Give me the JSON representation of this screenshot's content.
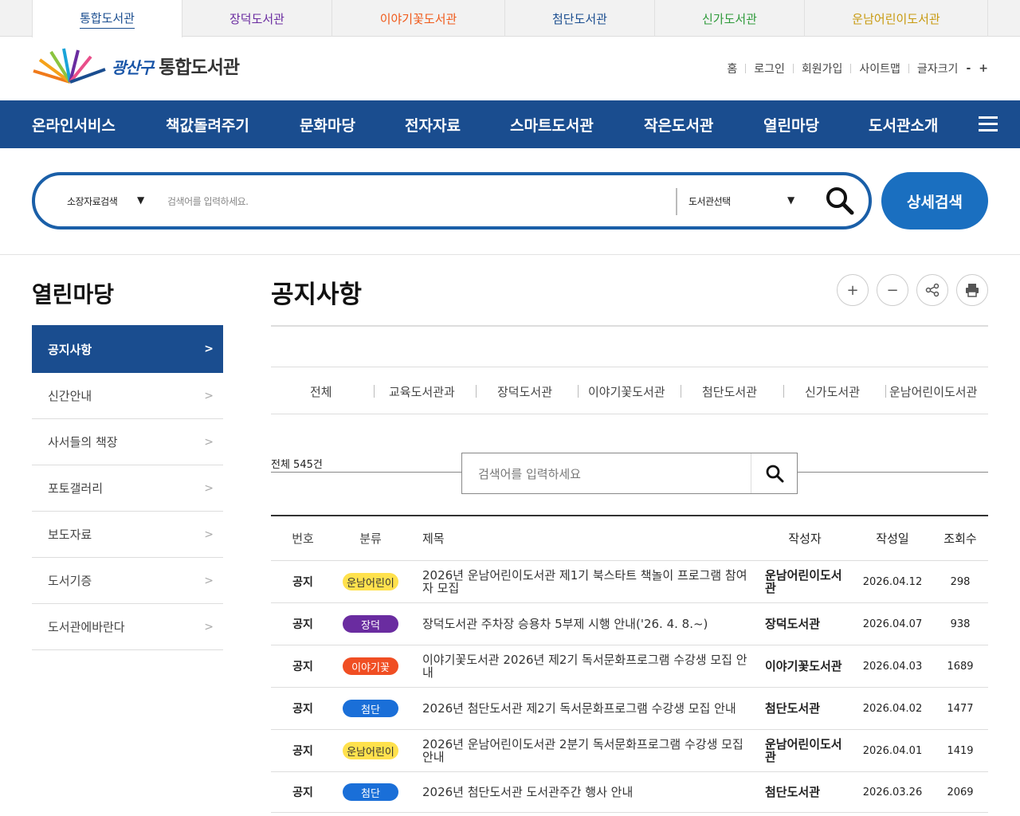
{
  "library_tabs": [
    {
      "label": "통합도서관",
      "color": "#1a4d8f"
    },
    {
      "label": "장덕도서관",
      "color": "#6a2ca0"
    },
    {
      "label": "이야기꽃도서관",
      "color": "#f05a1a"
    },
    {
      "label": "첨단도서관",
      "color": "#1a4d8f"
    },
    {
      "label": "신가도서관",
      "color": "#2e9a3a"
    },
    {
      "label": "운남어린이도서관",
      "color": "#c89a10"
    }
  ],
  "header": {
    "logo_prefix": "광산구",
    "logo_main": "통합도서관",
    "util_links": [
      "홈",
      "로그인",
      "회원가입",
      "사이트맵",
      "글자크기"
    ],
    "font_minus": "-",
    "font_plus": "+"
  },
  "gnb": [
    "온라인서비스",
    "책값돌려주기",
    "문화마당",
    "전자자료",
    "스마트도서관",
    "작은도서관",
    "열린마당",
    "도서관소개"
  ],
  "search": {
    "type_label": "소장자료검색",
    "placeholder": "검색어를 입력하세요.",
    "library_label": "도서관선택",
    "advanced_label": "상세검색"
  },
  "side": {
    "title": "열린마당",
    "items": [
      "공지사항",
      "신간안내",
      "사서들의 책장",
      "포토갤러리",
      "보도자료",
      "도서기증",
      "도서관에바란다"
    ]
  },
  "content": {
    "title": "공지사항",
    "category_tabs": [
      "전체",
      "교육도서관과",
      "장덕도서관",
      "이야기꽃도서관",
      "첨단도서관",
      "신가도서관",
      "운남어린이도서관"
    ],
    "total": "전체 545건",
    "search_placeholder": "검색어를 입력하세요"
  },
  "board": {
    "headers": {
      "no": "번호",
      "cat": "분류",
      "title": "제목",
      "author": "작성자",
      "date": "작성일",
      "views": "조회수"
    },
    "rows": [
      {
        "no": "공지",
        "cat": "운남어린이",
        "cat_color": "#ffe14d",
        "cat_text": "#333333",
        "title": "2026년 운남어린이도서관 제1기 북스타트 책놀이 프로그램 참여자 모집",
        "author": "운남어린이도서관",
        "date": "2026.04.12",
        "views": "298"
      },
      {
        "no": "공지",
        "cat": "장덕",
        "cat_color": "#6a2ca0",
        "cat_text": "#ffffff",
        "title": "장덕도서관 주차장 승용차 5부제 시행 안내('26. 4. 8.~)",
        "author": "장덕도서관",
        "date": "2026.04.07",
        "views": "938"
      },
      {
        "no": "공지",
        "cat": "이야기꽃",
        "cat_color": "#f04e23",
        "cat_text": "#ffffff",
        "title": "이야기꽃도서관 2026년 제2기 독서문화프로그램 수강생 모집 안내",
        "author": "이야기꽃도서관",
        "date": "2026.04.03",
        "views": "1689"
      },
      {
        "no": "공지",
        "cat": "첨단",
        "cat_color": "#1a6fd8",
        "cat_text": "#ffffff",
        "title": "2026년 첨단도서관 제2기 독서문화프로그램 수강생 모집 안내",
        "author": "첨단도서관",
        "date": "2026.04.02",
        "views": "1477"
      },
      {
        "no": "공지",
        "cat": "운남어린이",
        "cat_color": "#ffe14d",
        "cat_text": "#333333",
        "title": "2026년 운남어린이도서관 2분기 독서문화프로그램 수강생 모집 안내",
        "author": "운남어린이도서관",
        "date": "2026.04.01",
        "views": "1419"
      },
      {
        "no": "공지",
        "cat": "첨단",
        "cat_color": "#1a6fd8",
        "cat_text": "#ffffff",
        "title": "2026년 첨단도서관 도서관주간 행사 안내",
        "author": "첨단도서관",
        "date": "2026.03.26",
        "views": "2069"
      }
    ]
  },
  "colors": {
    "brand": "#1a4d8f",
    "search_border": "#1a5fa8",
    "advanced_btn": "#1a6fc0"
  }
}
